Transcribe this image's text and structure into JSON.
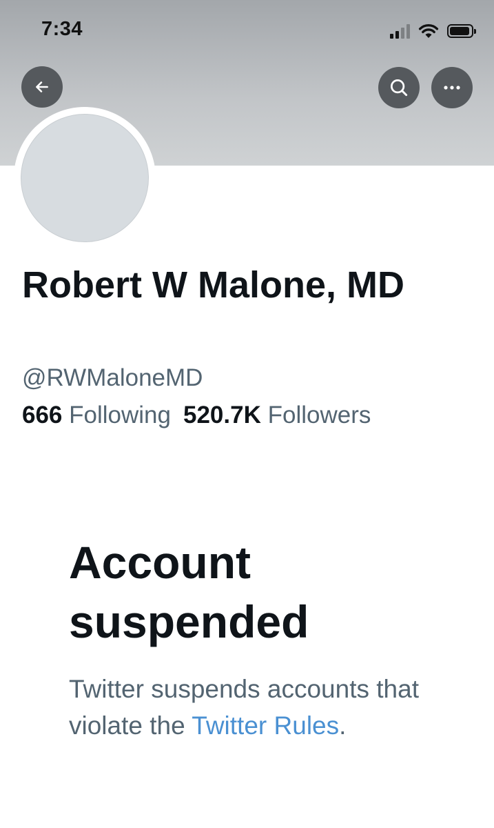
{
  "status_bar": {
    "time": "7:34",
    "icons": [
      "cellular-signal-icon",
      "wifi-icon",
      "battery-icon"
    ]
  },
  "header": {
    "back_icon": "arrow-left-icon",
    "search_icon": "search-icon",
    "more_icon": "more-horizontal-icon"
  },
  "profile": {
    "name": "Robert W Malone, MD",
    "handle": "@RWMaloneMD",
    "following_count": "666",
    "following_label": "Following",
    "followers_count": "520.7K",
    "followers_label": "Followers"
  },
  "suspension": {
    "title": "Account suspended",
    "message_prefix": "Twitter suspends accounts that violate the ",
    "link_text": "Twitter Rules",
    "message_suffix": "."
  },
  "colors": {
    "header_bg": "#b8bbbe",
    "button_bg": "#55595d",
    "secondary_text": "#536471",
    "link": "#4a90d2",
    "primary_text": "#0f1419"
  }
}
